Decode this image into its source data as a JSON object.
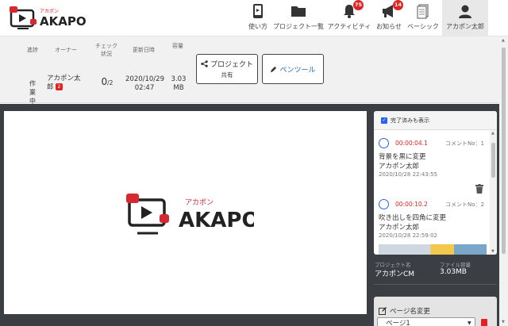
{
  "brand": {
    "name": "AKAPON",
    "kana": "アカポン",
    "accent": "#d7282f"
  },
  "nav": [
    {
      "key": "usage",
      "label": "使い方",
      "icon": "tablet-icon"
    },
    {
      "key": "projects",
      "label": "プロジェクト一覧",
      "icon": "folder-icon"
    },
    {
      "key": "activity",
      "label": "アクティビティ",
      "icon": "bell-icon",
      "badge": "75"
    },
    {
      "key": "notice",
      "label": "お知らせ",
      "icon": "megaphone-icon",
      "badge": "14"
    },
    {
      "key": "basic",
      "label": "ベーシック",
      "icon": "plan-icon"
    },
    {
      "key": "user",
      "label": "アカポン太郎",
      "icon": "user-icon"
    }
  ],
  "info": {
    "headers": {
      "progress": "進捗",
      "owner": "オーナー",
      "check": "チェック状況",
      "updated": "更新日時",
      "size": "容量"
    },
    "progress": "作業中",
    "owner_name": "アカポン太郎",
    "owner_badge": "2",
    "check_done": "0",
    "check_total": "/2",
    "updated_date": "2020/10/29",
    "updated_time": "02:47",
    "size_value": "3.03",
    "size_unit": "MB"
  },
  "buttons": {
    "share_title": "プロジェクト",
    "share_sub": "共有",
    "pen_tool": "ペンツール"
  },
  "comments_panel": {
    "show_done_label": "完了済みも表示",
    "items": [
      {
        "time": "00:00:04.1",
        "no": "コメントNo：1",
        "text": "背景を黒に変更",
        "user": "アカポン太郎",
        "date": "2020/10/28 22:43:55"
      },
      {
        "time": "00:00:10.2",
        "no": "コメントNo：2",
        "text": "吹き出しを四角に変更",
        "user": "アカポン太郎",
        "date": "2020/10/28 22:59:02"
      }
    ]
  },
  "meta": {
    "project_label": "プロジェクト名",
    "project_name": "アカポンCM",
    "size_label": "ファイル容量",
    "size_value": "3.03MB"
  },
  "page_name": {
    "title": "ページ名変更",
    "value": "ページ1"
  }
}
